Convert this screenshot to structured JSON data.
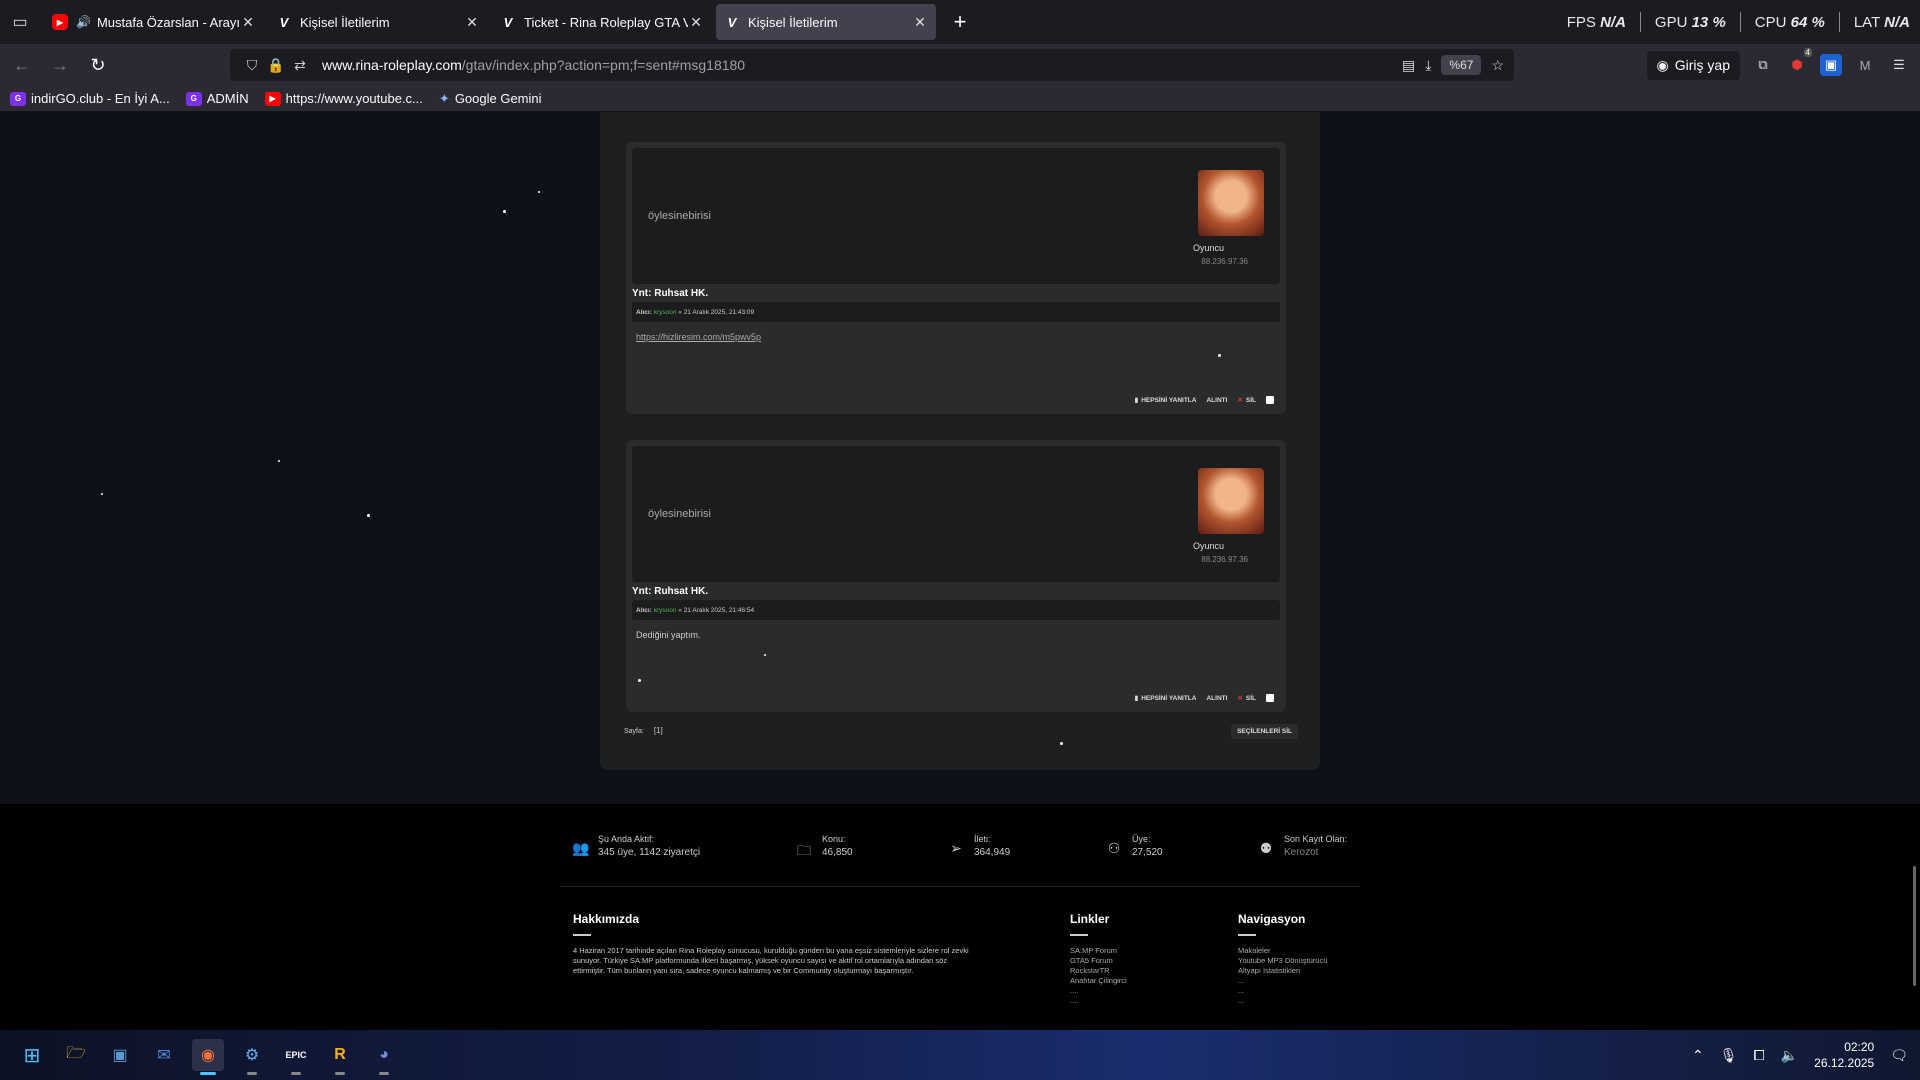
{
  "tabs": [
    {
      "title": "Mustafa Özarslan - Arayı Aç",
      "favicon": "youtube-icon",
      "audio": true,
      "active": false
    },
    {
      "title": "Kişisel İletilerim",
      "favicon": "rina-v-icon",
      "active": false
    },
    {
      "title": "Ticket - Rina Roleplay GTA V | w",
      "favicon": "rina-v-icon",
      "active": false
    },
    {
      "title": "Kişisel İletilerim",
      "favicon": "rina-v-icon",
      "active": true
    }
  ],
  "overlay": {
    "fps_label": "FPS",
    "fps_value": "N/A",
    "gpu_label": "GPU",
    "gpu_value": "13 %",
    "cpu_label": "CPU",
    "cpu_value": "64 %",
    "lat_label": "LAT",
    "lat_value": "N/A"
  },
  "urlbar": {
    "url_domain": "www.rina-roleplay.com",
    "url_path": "/gtav/index.php?action=pm;f=sent#msg18180",
    "zoom": "%67"
  },
  "nav": {
    "login_label": "Giriş yap",
    "badge_count": "4"
  },
  "bookmarks": [
    {
      "label": "indirGO.club - En İyi A...",
      "icon": "indirgo-icon"
    },
    {
      "label": "ADMİN",
      "icon": "indirgo-icon"
    },
    {
      "label": "https://www.youtube.c...",
      "icon": "youtube-icon"
    },
    {
      "label": "Google Gemini",
      "icon": "gemini-icon"
    }
  ],
  "messages": [
    {
      "username": "öylesinebirisi",
      "role": "Oyuncu",
      "ip": "88.236.97.36",
      "subject": "Ynt: Ruhsat HK.",
      "meta_prefix": "Alıcı: ",
      "meta_who": "krysoon",
      "meta_suffix": " « 21 Aralık 2025, 21:43:09",
      "body": "https://hizliresim.com/m5pwv5p",
      "body_is_link": true
    },
    {
      "username": "öylesinebirisi",
      "role": "Oyuncu",
      "ip": "88.236.97.36",
      "subject": "Ynt: Ruhsat HK.",
      "meta_prefix": "Alıcı: ",
      "meta_who": "krysoon",
      "meta_suffix": " « 21 Aralık 2025, 21:46:54",
      "body": "Dediğini yaptım.",
      "body_is_link": false
    }
  ],
  "actions": {
    "reply_all": "HEPSİNİ YANITLA",
    "quote": "ALINTI",
    "delete": "SİL"
  },
  "pager": {
    "label": "Sayfa:",
    "current": "[1]",
    "delete_selected": "SEÇİLENLERİ SİL"
  },
  "stats": [
    {
      "label": "Şu Anda Aktif:",
      "value": "345 üye, 1142 ziyaretçi",
      "icon": "users-icon"
    },
    {
      "label": "Konu:",
      "value": "46,850",
      "icon": "folder-icon"
    },
    {
      "label": "İleti:",
      "value": "364,949",
      "icon": "send-icon"
    },
    {
      "label": "Üye:",
      "value": "27,520",
      "icon": "group-icon"
    },
    {
      "label": "Son Kayıt Olan:",
      "value": "Kerozot",
      "icon": "user-plus-icon"
    }
  ],
  "footer": {
    "about_title": "Hakkımızda",
    "about_text": "4 Haziran 2017 tarihinde açılan Rina Roleplay sunucusu, kurulduğu günden bu yana eşsiz sistemleriyle sizlere rol zevki sunuyor. Türkiye SA:MP platformunda ilkleri başarmış, yüksek oyuncu sayısı ve aktif rol ortamlarıyla adından söz ettirmiştir. Tüm bunların yanı sıra, sadece oyuncu kalmamış ve bir Community oluşturmayı başarmıştır.",
    "links_title": "Linkler",
    "links": [
      "SA:MP Forum",
      "GTA5 Forum",
      "RockstarTR",
      "Anahtar Çilingirci",
      "....",
      "...."
    ],
    "nav_title": "Navigasyon",
    "nav_links": [
      "Makaleler",
      "Youtube MP3 Dönüştürücü",
      "Altyapı İstatistikleri",
      "...",
      "...",
      "..."
    ]
  },
  "taskbar": {
    "apps": [
      "windows-start-icon",
      "file-explorer-icon",
      "app-icon",
      "mail-icon",
      "firefox-icon",
      "gear-app-icon",
      "epic-games-icon",
      "rockstar-icon",
      "discord-icon"
    ],
    "time": "02:20",
    "date": "26.12.2025"
  }
}
